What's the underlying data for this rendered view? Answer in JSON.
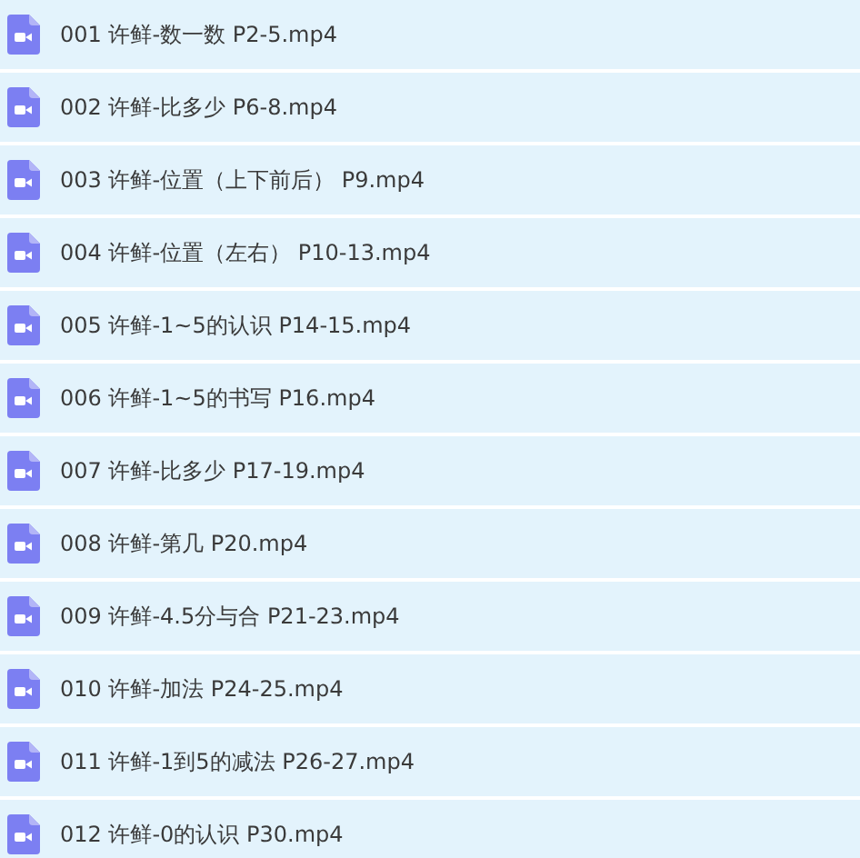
{
  "files": [
    {
      "name": "001 许鲜-数一数 P2-5.mp4"
    },
    {
      "name": "002 许鲜-比多少 P6-8.mp4"
    },
    {
      "name": "003 许鲜-位置（上下前后） P9.mp4"
    },
    {
      "name": "004 许鲜-位置（左右） P10-13.mp4"
    },
    {
      "name": "005 许鲜-1~5的认识 P14-15.mp4"
    },
    {
      "name": "006 许鲜-1~5的书写 P16.mp4"
    },
    {
      "name": "007 许鲜-比多少 P17-19.mp4"
    },
    {
      "name": "008 许鲜-第几 P20.mp4"
    },
    {
      "name": "009 许鲜-4.5分与合 P21-23.mp4"
    },
    {
      "name": "010 许鲜-加法 P24-25.mp4"
    },
    {
      "name": "011 许鲜-1到5的减法 P26-27.mp4"
    },
    {
      "name": "012 许鲜-0的认识 P30.mp4"
    }
  ]
}
